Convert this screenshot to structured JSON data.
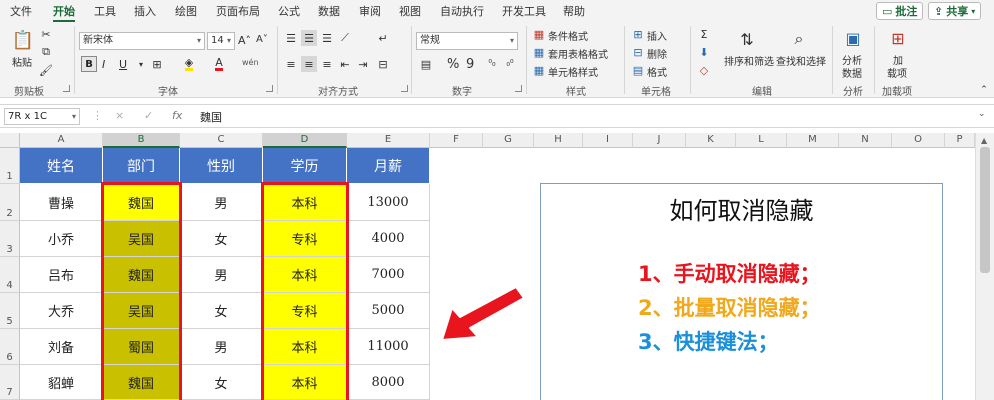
{
  "menu": {
    "tabs": [
      "文件",
      "开始",
      "工具",
      "插入",
      "绘图",
      "页面布局",
      "公式",
      "数据",
      "审阅",
      "视图",
      "自动执行",
      "开发工具",
      "帮助"
    ],
    "active": "开始",
    "comment_label": "批注",
    "share_label": "共享"
  },
  "ribbon": {
    "clipboard": {
      "paste": "粘贴",
      "group": "剪贴板"
    },
    "font": {
      "name": "新宋体",
      "size": "14",
      "bold": "B",
      "italic": "I",
      "underline": "U",
      "grow": "A˄",
      "shrink": "A˅",
      "wen": "wén",
      "group": "字体"
    },
    "alignment": {
      "group": "对齐方式"
    },
    "number": {
      "format": "常规",
      "percent": "%",
      "comma": "9",
      "group": "数字"
    },
    "styles": {
      "conditional": "条件格式",
      "table": "套用表格格式",
      "cell": "单元格样式",
      "group": "样式"
    },
    "cells": {
      "insert": "插入",
      "delete": "删除",
      "format": "格式",
      "group": "单元格"
    },
    "editing": {
      "sort": "排序和筛选",
      "find": "查找和选择",
      "group": "编辑"
    },
    "analysis": {
      "data": "分析",
      "data2": "数据",
      "group": "分析"
    },
    "addins": {
      "add": "加",
      "add2": "载项",
      "group": "加载项"
    }
  },
  "formula_bar": {
    "name_box": "7R x 1C",
    "cancel": "×",
    "enter": "✓",
    "fx": "fx",
    "content": "魏国"
  },
  "columns": [
    "A",
    "B",
    "C",
    "D",
    "E",
    "F",
    "G",
    "H",
    "I",
    "J",
    "K",
    "L",
    "M",
    "N",
    "O",
    "P"
  ],
  "rows": [
    "1",
    "2",
    "3",
    "4",
    "5",
    "6",
    "7"
  ],
  "table": {
    "headers": [
      "姓名",
      "部门",
      "性别",
      "学历",
      "月薪"
    ],
    "rows": [
      [
        "曹操",
        "魏国",
        "男",
        "本科",
        "13000"
      ],
      [
        "小乔",
        "吴国",
        "女",
        "专科",
        "4000"
      ],
      [
        "吕布",
        "魏国",
        "男",
        "本科",
        "7000"
      ],
      [
        "大乔",
        "吴国",
        "女",
        "专科",
        "5000"
      ],
      [
        "刘备",
        "蜀国",
        "男",
        "本科",
        "11000"
      ],
      [
        "貂蝉",
        "魏国",
        "女",
        "本科",
        "8000"
      ]
    ]
  },
  "textbox": {
    "title": "如何取消隐藏",
    "items": [
      {
        "text": "1、手动取消隐藏；",
        "color": "#e8151e"
      },
      {
        "text": "2、批量取消隐藏；",
        "color": "#f0a81c"
      },
      {
        "text": "3、快捷键法；",
        "color": "#1b8fd8"
      }
    ]
  },
  "colors": {
    "accent": "#1d6b3a",
    "header_fill": "#4472c4",
    "highlight_yellow": "#ffff00",
    "highlight_olive": "#c9c000",
    "red_border": "#e8151e"
  }
}
